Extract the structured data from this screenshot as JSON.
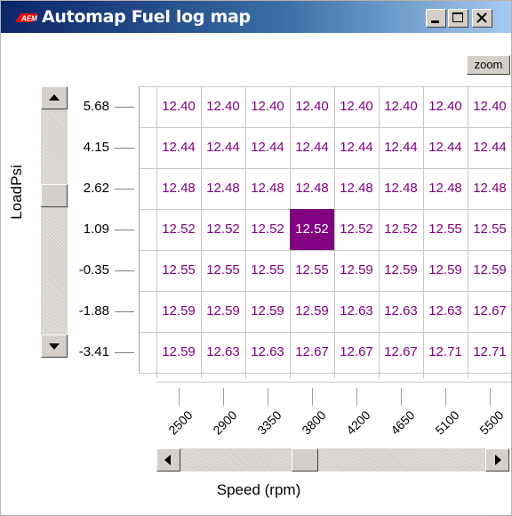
{
  "window": {
    "title": "Automap Fuel log map",
    "logo_text": "AEM"
  },
  "toolbar": {
    "zoom_label": "zoom"
  },
  "y_axis": {
    "label": "LoadPsi",
    "ticks": [
      "5.68",
      "4.15",
      "2.62",
      "1.09",
      "-0.35",
      "-1.88",
      "-3.41"
    ]
  },
  "x_axis": {
    "label": "Speed (rpm)",
    "ticks": [
      "2500",
      "2900",
      "3350",
      "3800",
      "4200",
      "4650",
      "5100",
      "5500"
    ]
  },
  "table": {
    "rows": [
      [
        "12.40",
        "12.40",
        "12.40",
        "12.40",
        "12.40",
        "12.40",
        "12.40",
        "12.40"
      ],
      [
        "12.44",
        "12.44",
        "12.44",
        "12.44",
        "12.44",
        "12.44",
        "12.44",
        "12.44"
      ],
      [
        "12.48",
        "12.48",
        "12.48",
        "12.48",
        "12.48",
        "12.48",
        "12.48",
        "12.48"
      ],
      [
        "12.52",
        "12.52",
        "12.52",
        "12.52",
        "12.52",
        "12.52",
        "12.55",
        "12.55"
      ],
      [
        "12.55",
        "12.55",
        "12.55",
        "12.55",
        "12.59",
        "12.59",
        "12.59",
        "12.59"
      ],
      [
        "12.59",
        "12.59",
        "12.59",
        "12.59",
        "12.63",
        "12.63",
        "12.63",
        "12.67"
      ],
      [
        "12.59",
        "12.63",
        "12.63",
        "12.67",
        "12.67",
        "12.67",
        "12.71",
        "12.71"
      ]
    ],
    "selected": {
      "row": 3,
      "col": 3
    }
  },
  "colors": {
    "cell_text": "#800080",
    "selected_bg": "#800080",
    "grid": "#c8c8c8"
  }
}
